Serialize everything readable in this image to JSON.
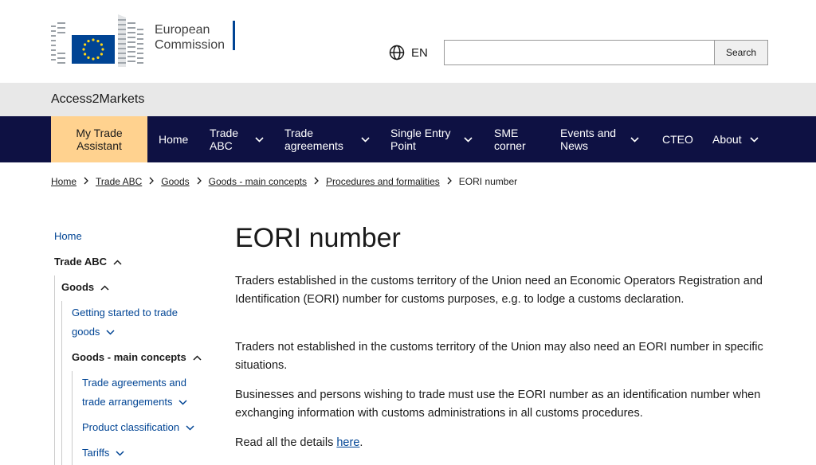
{
  "header": {
    "logo_line1": "European",
    "logo_line2": "Commission",
    "lang_code": "EN",
    "search_placeholder": "",
    "search_button": "Search"
  },
  "site_name": "Access2Markets",
  "nav": {
    "items": [
      {
        "line1": "My Trade",
        "line2": "Assistant"
      },
      {
        "line1": "Home",
        "line2": ""
      },
      {
        "line1": "Trade",
        "line2": "ABC"
      },
      {
        "line1": "Trade",
        "line2": "agreements"
      },
      {
        "line1": "Single Entry",
        "line2": "Point"
      },
      {
        "line1": "SME",
        "line2": "corner"
      },
      {
        "line1": "Events and",
        "line2": "News"
      },
      {
        "line1": "CTEO",
        "line2": ""
      },
      {
        "line1": "About",
        "line2": ""
      }
    ]
  },
  "breadcrumb": [
    "Home",
    "Trade ABC",
    "Goods",
    "Goods - main concepts",
    "Procedures and formalities",
    "EORI number"
  ],
  "sidebar": {
    "home": "Home",
    "trade_abc": "Trade ABC",
    "goods": "Goods",
    "getting_started_1": "Getting started to trade",
    "getting_started_2": "goods",
    "main_concepts": "Goods - main concepts",
    "trade_agreements_1": "Trade agreements and",
    "trade_agreements_2": "trade arrangements",
    "product_classification": "Product classification",
    "tariffs": "Tariffs"
  },
  "main": {
    "title": "EORI number",
    "p1": "Traders established in the customs territory of the Union need an Economic Operators Registration and Identification (EORI) number for customs purposes, e.g. to lodge a customs declaration.",
    "p2": "Traders not established in the customs territory of the Union may also need an EORI number in specific situations.",
    "p3": "Businesses and persons wishing to trade must use the EORI number as an identification number when exchanging information with customs administrations in all customs procedures.",
    "p4_prefix": "Read all the details ",
    "p4_link": "here",
    "p4_suffix": "."
  },
  "colors": {
    "nav_bg": "#0e1143",
    "nav_active": "#ffd28f",
    "link": "#004494",
    "eu_blue": "#004494",
    "eu_star": "#ffd617"
  }
}
